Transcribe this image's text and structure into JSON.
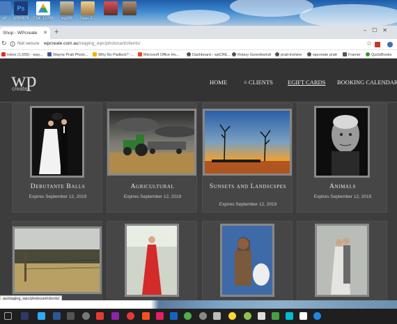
{
  "desktop": {
    "icons": [
      {
        "label": "off",
        "color": "#4a7dbf"
      },
      {
        "label": "WPP4578",
        "color": "#1f3b73"
      },
      {
        "label": "CMF_E9708...",
        "color": "#2fa84f"
      },
      {
        "label": "img206",
        "color": "#7a6a4c"
      },
      {
        "label": "Owen E...",
        "color": "#c8a060"
      },
      {
        "label": "...",
        "color": "#c04040"
      },
      {
        "label": "...",
        "color": "#806050"
      }
    ]
  },
  "browser": {
    "tab_title": "Shop - WPcreate",
    "not_secure_label": "Not secure",
    "url_domain": "wpcreate.com.au",
    "url_path": "/staging_wpc/photocart/clients/",
    "bookmarks": [
      {
        "label": "Inbox (1,555) - way...",
        "color": "#d93025"
      },
      {
        "label": "Wayne Pratt Photo...",
        "color": "#3b5998"
      },
      {
        "label": "Why No Padlock? -...",
        "color": "#f4b400"
      },
      {
        "label": "Microsoft Office Ho...",
        "color": "#e94b24"
      },
      {
        "label": "Dashboard ‹ wpCRE...",
        "color": "#555555"
      },
      {
        "label": "Rotary Goondiwindi",
        "color": "#555555"
      },
      {
        "label": "pratt-inshine",
        "color": "#555555"
      },
      {
        "label": "wpcreate pratt",
        "color": "#555555"
      },
      {
        "label": "Framer",
        "color": "#555555"
      },
      {
        "label": "QuickBooks",
        "color": "#2ca01c"
      }
    ],
    "status_url": "au/staging_wpc/photocart/clients/"
  },
  "site": {
    "logo": "wp",
    "logo_sub": "create",
    "nav": {
      "home": "HOME",
      "clients": "≡ CLIENTS",
      "egift": "EGIFT CARDS",
      "booking": "BOOKING CALENDAR"
    },
    "galleries": [
      {
        "title": "Debutante Balls",
        "expires": "Expires September 12, 2019"
      },
      {
        "title": "Agricultural",
        "expires": "Expires September 12, 2019"
      },
      {
        "title": "Sunsets and Landscspes",
        "expires": "Expires September 12, 2019"
      },
      {
        "title": "Animals",
        "expires": "Expires September 12, 2019"
      }
    ]
  }
}
